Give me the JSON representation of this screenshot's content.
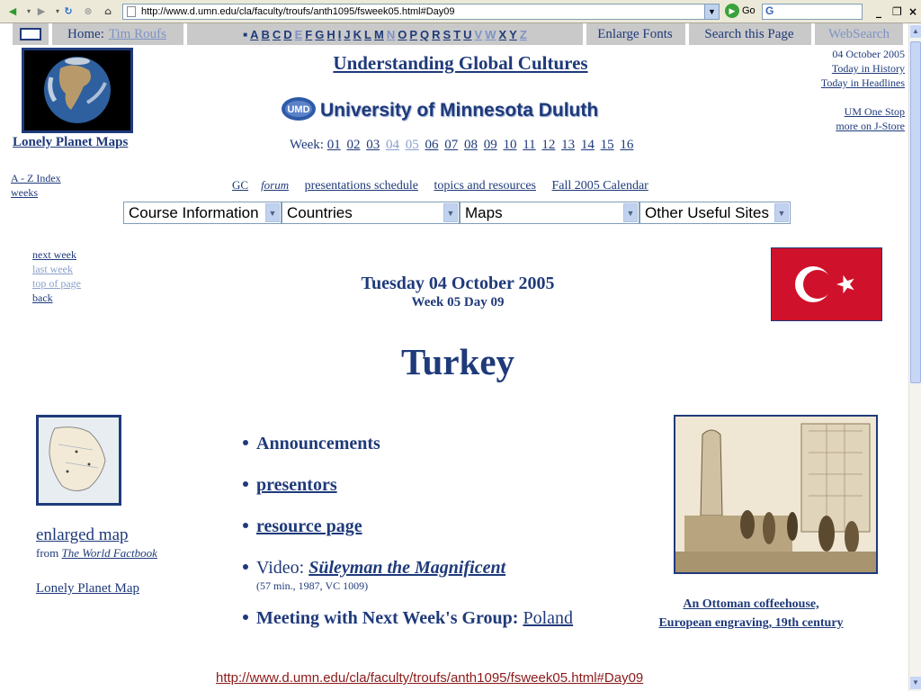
{
  "browser": {
    "address": "http://www.d.umn.edu/cla/faculty/troufs/anth1095/fsweek05.html#Day09",
    "go_label": "Go",
    "search_value": "G"
  },
  "nav": {
    "home_label": "Home:",
    "home_link": "Tim Roufs",
    "letters": [
      "A",
      "B",
      "C",
      "D",
      "E",
      "F",
      "G",
      "H",
      "I",
      "J",
      "K",
      "L",
      "M",
      "N",
      "O",
      "P",
      "Q",
      "R",
      "S",
      "T",
      "U",
      "V",
      "W",
      "X",
      "Y",
      "Z"
    ],
    "dim_letters": [
      "E",
      "N",
      "V",
      "W",
      "Z"
    ],
    "enlarge_fonts": "Enlarge Fonts",
    "search_page": "Search this Page",
    "websearch": "WebSearch"
  },
  "header": {
    "title": "Understanding Global Cultures",
    "university": "University of Minnesota Duluth",
    "logo_text": "UMD",
    "week_label": "Week:",
    "weeks": [
      "01",
      "02",
      "03",
      "04",
      "05",
      "06",
      "07",
      "08",
      "09",
      "10",
      "11",
      "12",
      "13",
      "14",
      "15",
      "16"
    ],
    "dim_weeks": [
      "04",
      "05"
    ],
    "lonely_planet_maps": "Lonely Planet Maps",
    "right_links": {
      "date": "04 October 2005",
      "history": "Today in History",
      "headlines": "Today in Headlines",
      "one_stop": "UM One Stop",
      "jstore": "more on J-Store"
    }
  },
  "sections": {
    "forum_prefix": "GC",
    "forum_suffix": "forum",
    "presentations": "presentations schedule",
    "topics": "topics and resources",
    "calendar": "Fall 2005 Calendar"
  },
  "dropdowns": {
    "course": "Course Information",
    "countries": "Countries",
    "maps": "Maps",
    "other": "Other Useful Sites"
  },
  "left_index": {
    "az": "A - Z Index",
    "weeks": "weeks"
  },
  "left_nav": {
    "next": "next week",
    "last": "last week",
    "top": "top of page",
    "back": "back"
  },
  "day": {
    "date": "Tuesday 04 October 2005",
    "week_day": "Week 05 Day 09",
    "country": "Turkey"
  },
  "map_panel": {
    "enlarged_map": "enlarged map",
    "from_prefix": "from",
    "from_source": "The World Factbook",
    "lonely_planet_map": "Lonely Planet Map"
  },
  "agenda": {
    "announcements": "Announcements",
    "presentors": "presentors",
    "resource_page": "resource page",
    "video_prefix": "Video:",
    "video_title": "Süleyman the Magnificent",
    "video_note": "(57 min., 1987,  VC 1009)",
    "meeting_prefix": "Meeting with Next Week's Group:",
    "meeting_country": "Poland"
  },
  "engraving": {
    "caption_line1": "An Ottoman coffeehouse,",
    "caption_line2": "European engraving, 19th century"
  },
  "status": {
    "url": "http://www.d.umn.edu/cla/faculty/troufs/anth1095/fsweek05.html#Day09"
  }
}
